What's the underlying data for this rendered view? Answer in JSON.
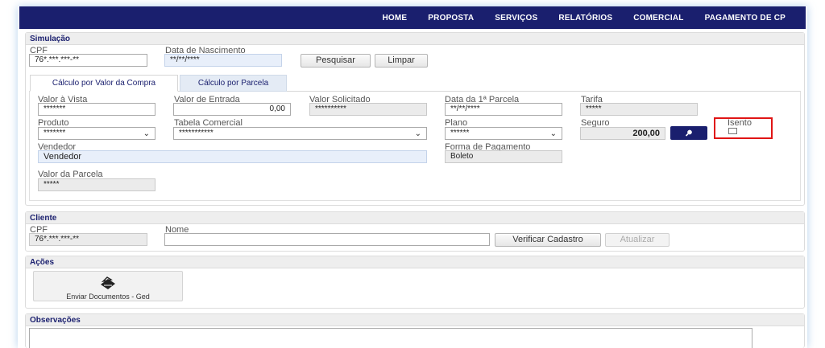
{
  "nav": [
    "HOME",
    "PROPOSTA",
    "SERVIÇOS",
    "RELATÓRIOS",
    "COMERCIAL",
    "PAGAMENTO DE CP"
  ],
  "simulacao": {
    "title": "Simulação",
    "cpf_label": "CPF",
    "cpf_value": "76*.***.***-**",
    "nascimento_label": "Data de Nascimento",
    "nascimento_value": "**/**/****",
    "pesquisar": "Pesquisar",
    "limpar": "Limpar"
  },
  "tabs": [
    "Cálculo por Valor da Compra",
    "Cálculo por Parcela"
  ],
  "form": {
    "valor_vista_label": "Valor à Vista",
    "valor_vista_value": "*******",
    "valor_entrada_label": "Valor de Entrada",
    "valor_entrada_value": "0,00",
    "valor_solicitado_label": "Valor Solicitado",
    "valor_solicitado_value": "**********",
    "data_parcela_label": "Data da 1ª Parcela",
    "data_parcela_value": "**/**/****",
    "tarifa_label": "Tarifa",
    "tarifa_value": "*****",
    "produto_label": "Produto",
    "produto_value": "*******",
    "tabela_label": "Tabela Comercial",
    "tabela_value": "***********",
    "plano_label": "Plano",
    "plano_value": "******",
    "seguro_label": "Seguro",
    "seguro_value": "200,00",
    "isento_label": "Isento",
    "vendedor_label": "Vendedor",
    "vendedor_value": "Vendedor",
    "forma_label": "Forma de Pagamento",
    "forma_value": "Boleto",
    "parcela_label": "Valor da Parcela",
    "parcela_value": "*****"
  },
  "cliente": {
    "title": "Cliente",
    "cpf_label": "CPF",
    "cpf_value": "76*.***.***-**",
    "nome_label": "Nome",
    "nome_value": "",
    "verificar": "Verificar Cadastro",
    "atualizar": "Atualizar"
  },
  "acoes": {
    "title": "Ações",
    "enviar": "Enviar Documentos - Ged"
  },
  "observacoes": {
    "title": "Observações"
  },
  "colors": {
    "nav_bg": "#1a1f6e",
    "highlight": "#e01515"
  }
}
